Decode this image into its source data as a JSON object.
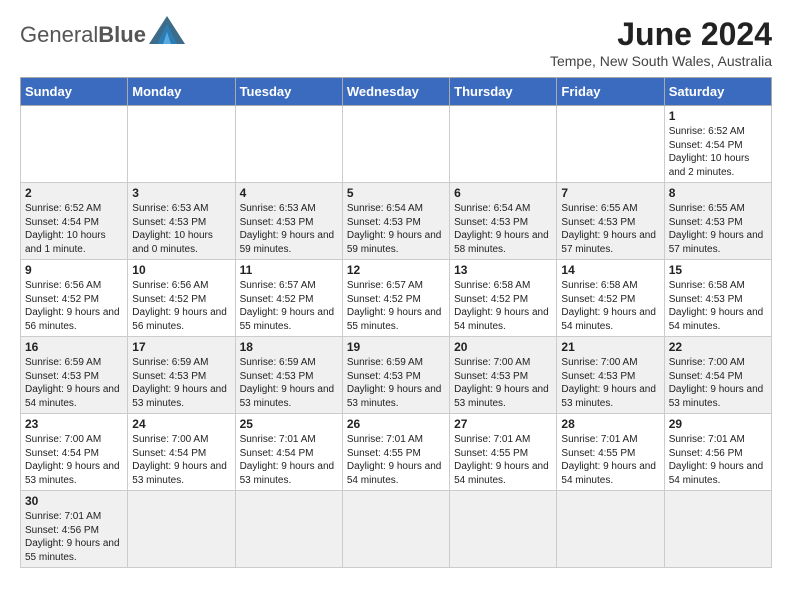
{
  "header": {
    "logo_general": "General",
    "logo_blue": "Blue",
    "month_title": "June 2024",
    "subtitle": "Tempe, New South Wales, Australia"
  },
  "weekdays": [
    "Sunday",
    "Monday",
    "Tuesday",
    "Wednesday",
    "Thursday",
    "Friday",
    "Saturday"
  ],
  "weeks": [
    [
      {
        "day": "",
        "info": ""
      },
      {
        "day": "",
        "info": ""
      },
      {
        "day": "",
        "info": ""
      },
      {
        "day": "",
        "info": ""
      },
      {
        "day": "",
        "info": ""
      },
      {
        "day": "",
        "info": ""
      },
      {
        "day": "1",
        "info": "Sunrise: 6:52 AM\nSunset: 4:54 PM\nDaylight: 10 hours\nand 2 minutes."
      }
    ],
    [
      {
        "day": "2",
        "info": "Sunrise: 6:52 AM\nSunset: 4:54 PM\nDaylight: 10 hours\nand 1 minute."
      },
      {
        "day": "3",
        "info": "Sunrise: 6:53 AM\nSunset: 4:53 PM\nDaylight: 10 hours\nand 0 minutes."
      },
      {
        "day": "4",
        "info": "Sunrise: 6:53 AM\nSunset: 4:53 PM\nDaylight: 9 hours\nand 59 minutes."
      },
      {
        "day": "5",
        "info": "Sunrise: 6:54 AM\nSunset: 4:53 PM\nDaylight: 9 hours\nand 59 minutes."
      },
      {
        "day": "6",
        "info": "Sunrise: 6:54 AM\nSunset: 4:53 PM\nDaylight: 9 hours\nand 58 minutes."
      },
      {
        "day": "7",
        "info": "Sunrise: 6:55 AM\nSunset: 4:53 PM\nDaylight: 9 hours\nand 57 minutes."
      },
      {
        "day": "8",
        "info": "Sunrise: 6:55 AM\nSunset: 4:53 PM\nDaylight: 9 hours\nand 57 minutes."
      }
    ],
    [
      {
        "day": "9",
        "info": "Sunrise: 6:56 AM\nSunset: 4:52 PM\nDaylight: 9 hours\nand 56 minutes."
      },
      {
        "day": "10",
        "info": "Sunrise: 6:56 AM\nSunset: 4:52 PM\nDaylight: 9 hours\nand 56 minutes."
      },
      {
        "day": "11",
        "info": "Sunrise: 6:57 AM\nSunset: 4:52 PM\nDaylight: 9 hours\nand 55 minutes."
      },
      {
        "day": "12",
        "info": "Sunrise: 6:57 AM\nSunset: 4:52 PM\nDaylight: 9 hours\nand 55 minutes."
      },
      {
        "day": "13",
        "info": "Sunrise: 6:58 AM\nSunset: 4:52 PM\nDaylight: 9 hours\nand 54 minutes."
      },
      {
        "day": "14",
        "info": "Sunrise: 6:58 AM\nSunset: 4:52 PM\nDaylight: 9 hours\nand 54 minutes."
      },
      {
        "day": "15",
        "info": "Sunrise: 6:58 AM\nSunset: 4:53 PM\nDaylight: 9 hours\nand 54 minutes."
      }
    ],
    [
      {
        "day": "16",
        "info": "Sunrise: 6:59 AM\nSunset: 4:53 PM\nDaylight: 9 hours\nand 54 minutes."
      },
      {
        "day": "17",
        "info": "Sunrise: 6:59 AM\nSunset: 4:53 PM\nDaylight: 9 hours\nand 53 minutes."
      },
      {
        "day": "18",
        "info": "Sunrise: 6:59 AM\nSunset: 4:53 PM\nDaylight: 9 hours\nand 53 minutes."
      },
      {
        "day": "19",
        "info": "Sunrise: 6:59 AM\nSunset: 4:53 PM\nDaylight: 9 hours\nand 53 minutes."
      },
      {
        "day": "20",
        "info": "Sunrise: 7:00 AM\nSunset: 4:53 PM\nDaylight: 9 hours\nand 53 minutes."
      },
      {
        "day": "21",
        "info": "Sunrise: 7:00 AM\nSunset: 4:53 PM\nDaylight: 9 hours\nand 53 minutes."
      },
      {
        "day": "22",
        "info": "Sunrise: 7:00 AM\nSunset: 4:54 PM\nDaylight: 9 hours\nand 53 minutes."
      }
    ],
    [
      {
        "day": "23",
        "info": "Sunrise: 7:00 AM\nSunset: 4:54 PM\nDaylight: 9 hours\nand 53 minutes."
      },
      {
        "day": "24",
        "info": "Sunrise: 7:00 AM\nSunset: 4:54 PM\nDaylight: 9 hours\nand 53 minutes."
      },
      {
        "day": "25",
        "info": "Sunrise: 7:01 AM\nSunset: 4:54 PM\nDaylight: 9 hours\nand 53 minutes."
      },
      {
        "day": "26",
        "info": "Sunrise: 7:01 AM\nSunset: 4:55 PM\nDaylight: 9 hours\nand 54 minutes."
      },
      {
        "day": "27",
        "info": "Sunrise: 7:01 AM\nSunset: 4:55 PM\nDaylight: 9 hours\nand 54 minutes."
      },
      {
        "day": "28",
        "info": "Sunrise: 7:01 AM\nSunset: 4:55 PM\nDaylight: 9 hours\nand 54 minutes."
      },
      {
        "day": "29",
        "info": "Sunrise: 7:01 AM\nSunset: 4:56 PM\nDaylight: 9 hours\nand 54 minutes."
      }
    ],
    [
      {
        "day": "30",
        "info": "Sunrise: 7:01 AM\nSunset: 4:56 PM\nDaylight: 9 hours\nand 55 minutes."
      },
      {
        "day": "",
        "info": ""
      },
      {
        "day": "",
        "info": ""
      },
      {
        "day": "",
        "info": ""
      },
      {
        "day": "",
        "info": ""
      },
      {
        "day": "",
        "info": ""
      },
      {
        "day": "",
        "info": ""
      }
    ]
  ]
}
